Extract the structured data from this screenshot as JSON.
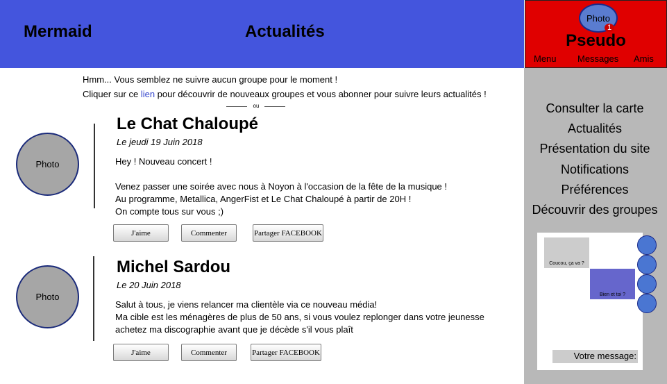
{
  "header": {
    "logo": "Mermaid",
    "title": "Actualités"
  },
  "profile": {
    "photo_label": "Photo",
    "notification_count": "1",
    "pseudo": "Pseudo",
    "nav": [
      "Menu",
      "Messages",
      "Amis"
    ]
  },
  "intro": {
    "line1": "Hmm... Vous semblez ne suivre aucun groupe pour le moment !",
    "line2_before": "Cliquer sur ce ",
    "line2_link": "lien",
    "line2_after": " pour découvrir de nouveaux groupes et vous abonner pour suivre leurs actualités !",
    "or": "ou"
  },
  "posts": [
    {
      "photo_label": "Photo",
      "title": "Le Chat Chaloupé",
      "date": "Le jeudi 19 Juin 2018",
      "lines": [
        "Hey ! Nouveau concert !",
        "",
        "Venez passer une soirée avec nous à Noyon à l'occasion de la fête de la musique !",
        "Au programme, Metallica, AngerFist et Le Chat Chaloupé à partir de 20H !",
        "On compte tous sur vous ;)"
      ],
      "actions": [
        "J'aime",
        "Commenter",
        "Partager FACEBOOK"
      ]
    },
    {
      "photo_label": "Photo",
      "title": "Michel Sardou",
      "date": "Le 20 Juin 2018",
      "lines": [
        "Salut à tous, je viens relancer ma clientèle via ce nouveau média!",
        "Ma cible est les ménagères de plus de 50 ans, si vous voulez replonger dans votre jeunesse",
        "achetez ma discographie avant que je décède s'il vous plaît"
      ],
      "actions": [
        "J'aime",
        "Commenter",
        "Partager FACEBOOK"
      ]
    }
  ],
  "sidebar": {
    "links": [
      "Consulter la carte",
      "Actualités",
      "Présentation du site",
      "Notifications",
      "Préférences",
      "Découvrir des groupes"
    ]
  },
  "chat": {
    "received": "Coucou, ça va ?",
    "sent": "Bien et toi ?",
    "input_placeholder": "Votre message:"
  },
  "colors": {
    "header": "#4455dd",
    "profile_box": "#e00000",
    "sidebar": "#b8b8b8",
    "link": "#3344cc"
  }
}
